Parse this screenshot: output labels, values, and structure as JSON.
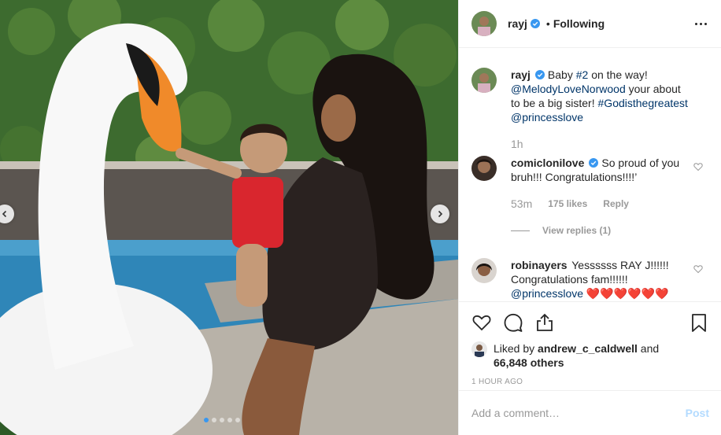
{
  "post": {
    "author": "rayj",
    "follow_status": "Following",
    "bullet": "•",
    "caption": {
      "username": "rayj",
      "text_1": "Baby",
      "hashtag_1": "#2",
      "text_2": "on the way!",
      "mention_1": "@MelodyLoveNorwood",
      "text_3": "your about to be a big sister!",
      "hashtag_2": "#Godisthegreatest",
      "mention_2": "@princesslove",
      "time": "1h"
    },
    "comments": [
      {
        "username": "comiclonilove",
        "verified": true,
        "text": "So proud of you bruh!!! Congratulations!!!!’",
        "time": "53m",
        "likes": "175 likes",
        "reply": "Reply",
        "view_replies": "View replies (1)"
      },
      {
        "username": "robinayers",
        "verified": false,
        "text": "Yessssss RAY J!!!!!! Congratulations fam!!!!!!",
        "mention": "@princesslove",
        "hearts": "❤️❤️❤️❤️❤️❤️"
      }
    ],
    "liked_by": {
      "prefix": "Liked by",
      "user": "andrew_c_caldwell",
      "conj": "and",
      "others": "66,848 others"
    },
    "timestamp": "1 HOUR AGO",
    "add_comment_placeholder": "Add a comment…",
    "post_label": "Post"
  },
  "carousel": {
    "slides": 5,
    "active": 0
  },
  "icons": {
    "verified": "verified-badge-icon",
    "more": "more-options-icon",
    "like": "heart-icon",
    "comment": "comment-icon",
    "share": "share-icon",
    "save": "bookmark-icon",
    "prev": "chevron-left-icon",
    "next": "chevron-right-icon"
  },
  "colors": {
    "link": "#003569",
    "verified": "#3897f0",
    "muted": "#999999",
    "post_disabled": "#b3dbff"
  }
}
